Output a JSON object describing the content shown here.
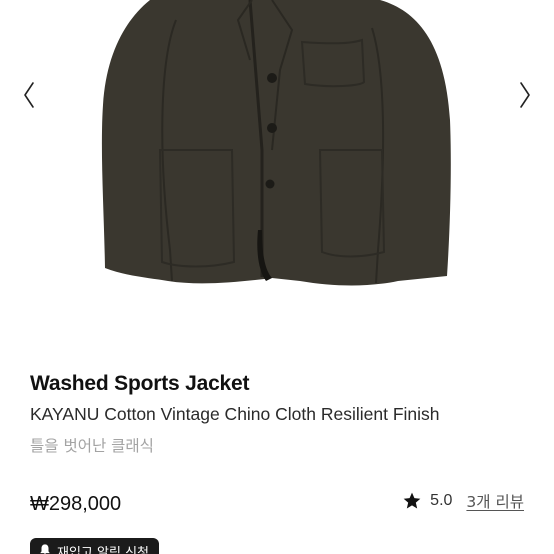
{
  "gallery": {
    "image_alt": "Washed Sports Jacket",
    "prev_icon": "chevron-left-icon",
    "next_icon": "chevron-right-icon"
  },
  "product": {
    "name": "Washed Sports Jacket",
    "subtitle": "KAYANU Cotton Vintage Chino Cloth Resilient Finish",
    "tagline": "틀을 벗어난 클래식",
    "price": "₩298,000"
  },
  "rating": {
    "icon": "star-icon",
    "score": "5.0",
    "reviews_label": "3개 리뷰"
  },
  "restock": {
    "icon": "bell-icon",
    "label": "재입고 알림 신청"
  },
  "colors": {
    "jacket": "#3a372f",
    "text_primary": "#111111",
    "text_muted": "#a3a3a3",
    "button_bg": "#1b1b1b"
  }
}
